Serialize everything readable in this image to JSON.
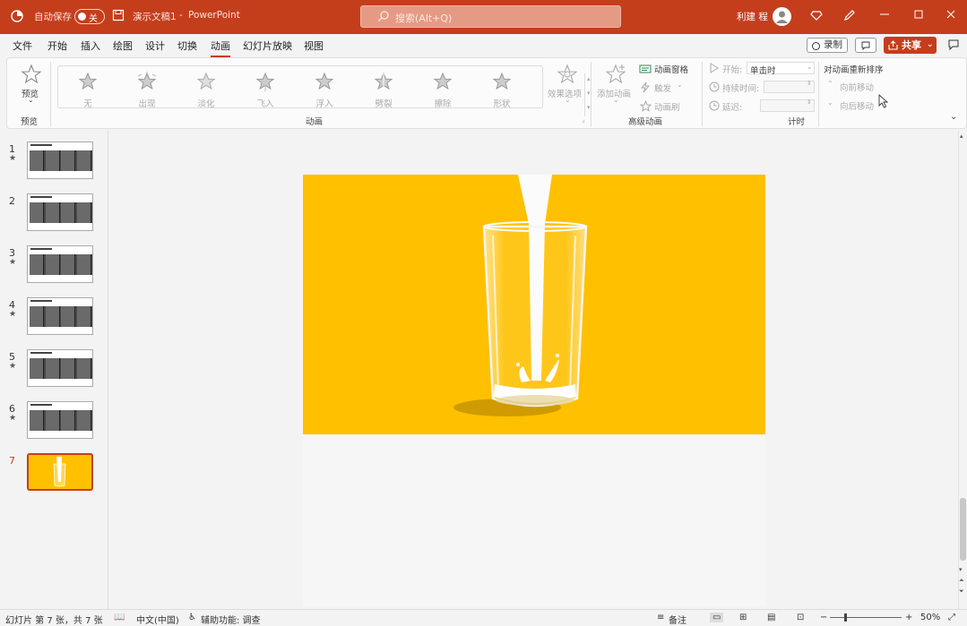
{
  "titlebar": {
    "autosave_label": "自动保存",
    "autosave_state": "关",
    "document_title": "演示文稿1",
    "separator": "-",
    "app_name": "PowerPoint",
    "search_placeholder": "搜索(Alt+Q)",
    "user_name": "利建 程"
  },
  "menu": [
    "文件",
    "开始",
    "插入",
    "绘图",
    "设计",
    "切换",
    "动画",
    "幻灯片放映",
    "视图"
  ],
  "active_menu": "动画",
  "actions": {
    "record": "录制",
    "share": "共享"
  },
  "ribbon": {
    "preview": {
      "label": "预览",
      "group": "预览"
    },
    "animations": [
      {
        "label": "无",
        "icon": "star-none-icon"
      },
      {
        "label": "出现",
        "icon": "star-appear-icon"
      },
      {
        "label": "淡化",
        "icon": "star-fade-icon"
      },
      {
        "label": "飞入",
        "icon": "star-fly-in-icon"
      },
      {
        "label": "浮入",
        "icon": "star-float-in-icon"
      },
      {
        "label": "劈裂",
        "icon": "star-split-icon"
      },
      {
        "label": "擦除",
        "icon": "star-wipe-icon"
      },
      {
        "label": "形状",
        "icon": "star-shape-icon"
      }
    ],
    "effect_options": "效果选项",
    "animation_group": "动画",
    "add_animation": "添加动画",
    "animation_pane": "动画窗格",
    "trigger": "触发",
    "animation_painter": "动画刷",
    "advanced_group": "高级动画",
    "start_label": "开始:",
    "start_value": "单击时",
    "duration_label": "持续时间:",
    "delay_label": "延迟:",
    "timing_group": "计时",
    "reorder_title": "对动画重新排序",
    "move_earlier": "向前移动",
    "move_later": "向后移动"
  },
  "slides": [
    {
      "number": "1",
      "has_animation": true
    },
    {
      "number": "2",
      "has_animation": false
    },
    {
      "number": "3",
      "has_animation": true
    },
    {
      "number": "4",
      "has_animation": true
    },
    {
      "number": "5",
      "has_animation": true
    },
    {
      "number": "6",
      "has_animation": true
    },
    {
      "number": "7",
      "has_animation": false,
      "selected": true
    }
  ],
  "slide_content": {
    "background_color": "#ffc000",
    "image": "milk-pouring-into-glass"
  },
  "status": {
    "slide_info": "幻灯片 第 7 张，共 7 张",
    "language": "中文(中国)",
    "accessibility": "辅助功能: 调查",
    "notes": "备注",
    "zoom": "50%"
  },
  "colors": {
    "accent": "#c43e1c",
    "slide_bg": "#ffc000"
  }
}
